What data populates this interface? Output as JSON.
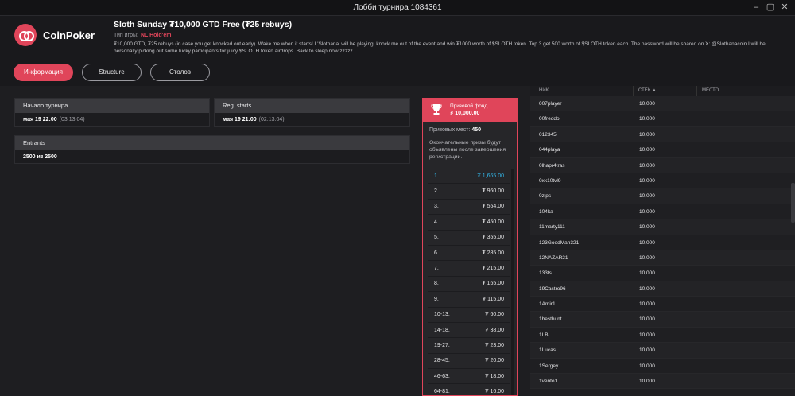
{
  "window": {
    "title": "Лобби турнира 1084361"
  },
  "brand": {
    "name": "CoinPoker",
    "accent": "#e0455a"
  },
  "tournament": {
    "name": "Sloth Sunday ₮10,000 GTD Free (₮25 rebuys)",
    "game_type_label": "Тип игры:",
    "game_type": "NL Hold'em",
    "description": "₮10,000 GTD, ₮25 rebuys (in case you get knocked out early). Wake me when it starts! I 'Slothana' will be playing, knock me out of the event and win ₮1000 worth of $SLOTH token. Top 3 get 500 worth of $SLOTH token each. The password will be shared on X: @Slothanacoin I will be personally picking out some lucky participants for juicy $SLOTH token airdrops. Back to sleep now zzzzz"
  },
  "tabs": [
    {
      "label": "Информация",
      "active": true
    },
    {
      "label": "Structure",
      "active": false
    },
    {
      "label": "Столов",
      "active": false
    }
  ],
  "info": {
    "start": {
      "label": "Начало турнира",
      "date": "мая 19 22:00",
      "countdown": "(03:13:04)"
    },
    "reg": {
      "label": "Reg. starts",
      "date": "мая 19 21:00",
      "countdown": "(02:13:04)"
    },
    "entrants": {
      "label": "Entrants",
      "value": "2500 из 2500"
    }
  },
  "prize": {
    "label": "Призовой фонд",
    "value": "₮ 10,000.00",
    "places_label": "Призовых мест:",
    "places": "450",
    "note": "Окончательные призы будут объявлены после завершения регистрации.",
    "rows": [
      {
        "place": "1.",
        "amount": "₮ 1,665.00"
      },
      {
        "place": "2.",
        "amount": "₮ 960.00"
      },
      {
        "place": "3.",
        "amount": "₮ 554.00"
      },
      {
        "place": "4.",
        "amount": "₮ 450.00"
      },
      {
        "place": "5.",
        "amount": "₮ 355.00"
      },
      {
        "place": "6.",
        "amount": "₮ 285.00"
      },
      {
        "place": "7.",
        "amount": "₮ 215.00"
      },
      {
        "place": "8.",
        "amount": "₮ 165.00"
      },
      {
        "place": "9.",
        "amount": "₮ 115.00"
      },
      {
        "place": "10-13.",
        "amount": "₮ 60.00"
      },
      {
        "place": "14-18.",
        "amount": "₮ 38.00"
      },
      {
        "place": "19-27.",
        "amount": "₮ 23.00"
      },
      {
        "place": "28-45.",
        "amount": "₮ 20.00"
      },
      {
        "place": "46-63.",
        "amount": "₮ 18.00"
      },
      {
        "place": "64-81.",
        "amount": "₮ 16.00"
      }
    ]
  },
  "players": {
    "headers": {
      "name": "НИК",
      "stack": "СТЕК",
      "place": "МЕСТО"
    },
    "rows": [
      {
        "name": "007player",
        "stack": "10,000"
      },
      {
        "name": "00freddo",
        "stack": "10,000"
      },
      {
        "name": "012345",
        "stack": "10,000"
      },
      {
        "name": "044playa",
        "stack": "10,000"
      },
      {
        "name": "0lhapr4tras",
        "stack": "10,000"
      },
      {
        "name": "0xk10tvl9",
        "stack": "10,000"
      },
      {
        "name": "0zips",
        "stack": "10,000"
      },
      {
        "name": "104ka",
        "stack": "10,000"
      },
      {
        "name": "11marty111",
        "stack": "10,000"
      },
      {
        "name": "123GoodMan321",
        "stack": "10,000"
      },
      {
        "name": "12NAZAR21",
        "stack": "10,000"
      },
      {
        "name": "133ts",
        "stack": "10,000"
      },
      {
        "name": "19Castro96",
        "stack": "10,000"
      },
      {
        "name": "1Amir1",
        "stack": "10,000"
      },
      {
        "name": "1besthunt",
        "stack": "10,000"
      },
      {
        "name": "1LBL",
        "stack": "10,000"
      },
      {
        "name": "1Lucas",
        "stack": "10,000"
      },
      {
        "name": "1Sergey",
        "stack": "10,000"
      },
      {
        "name": "1vento1",
        "stack": "10,000"
      }
    ]
  }
}
